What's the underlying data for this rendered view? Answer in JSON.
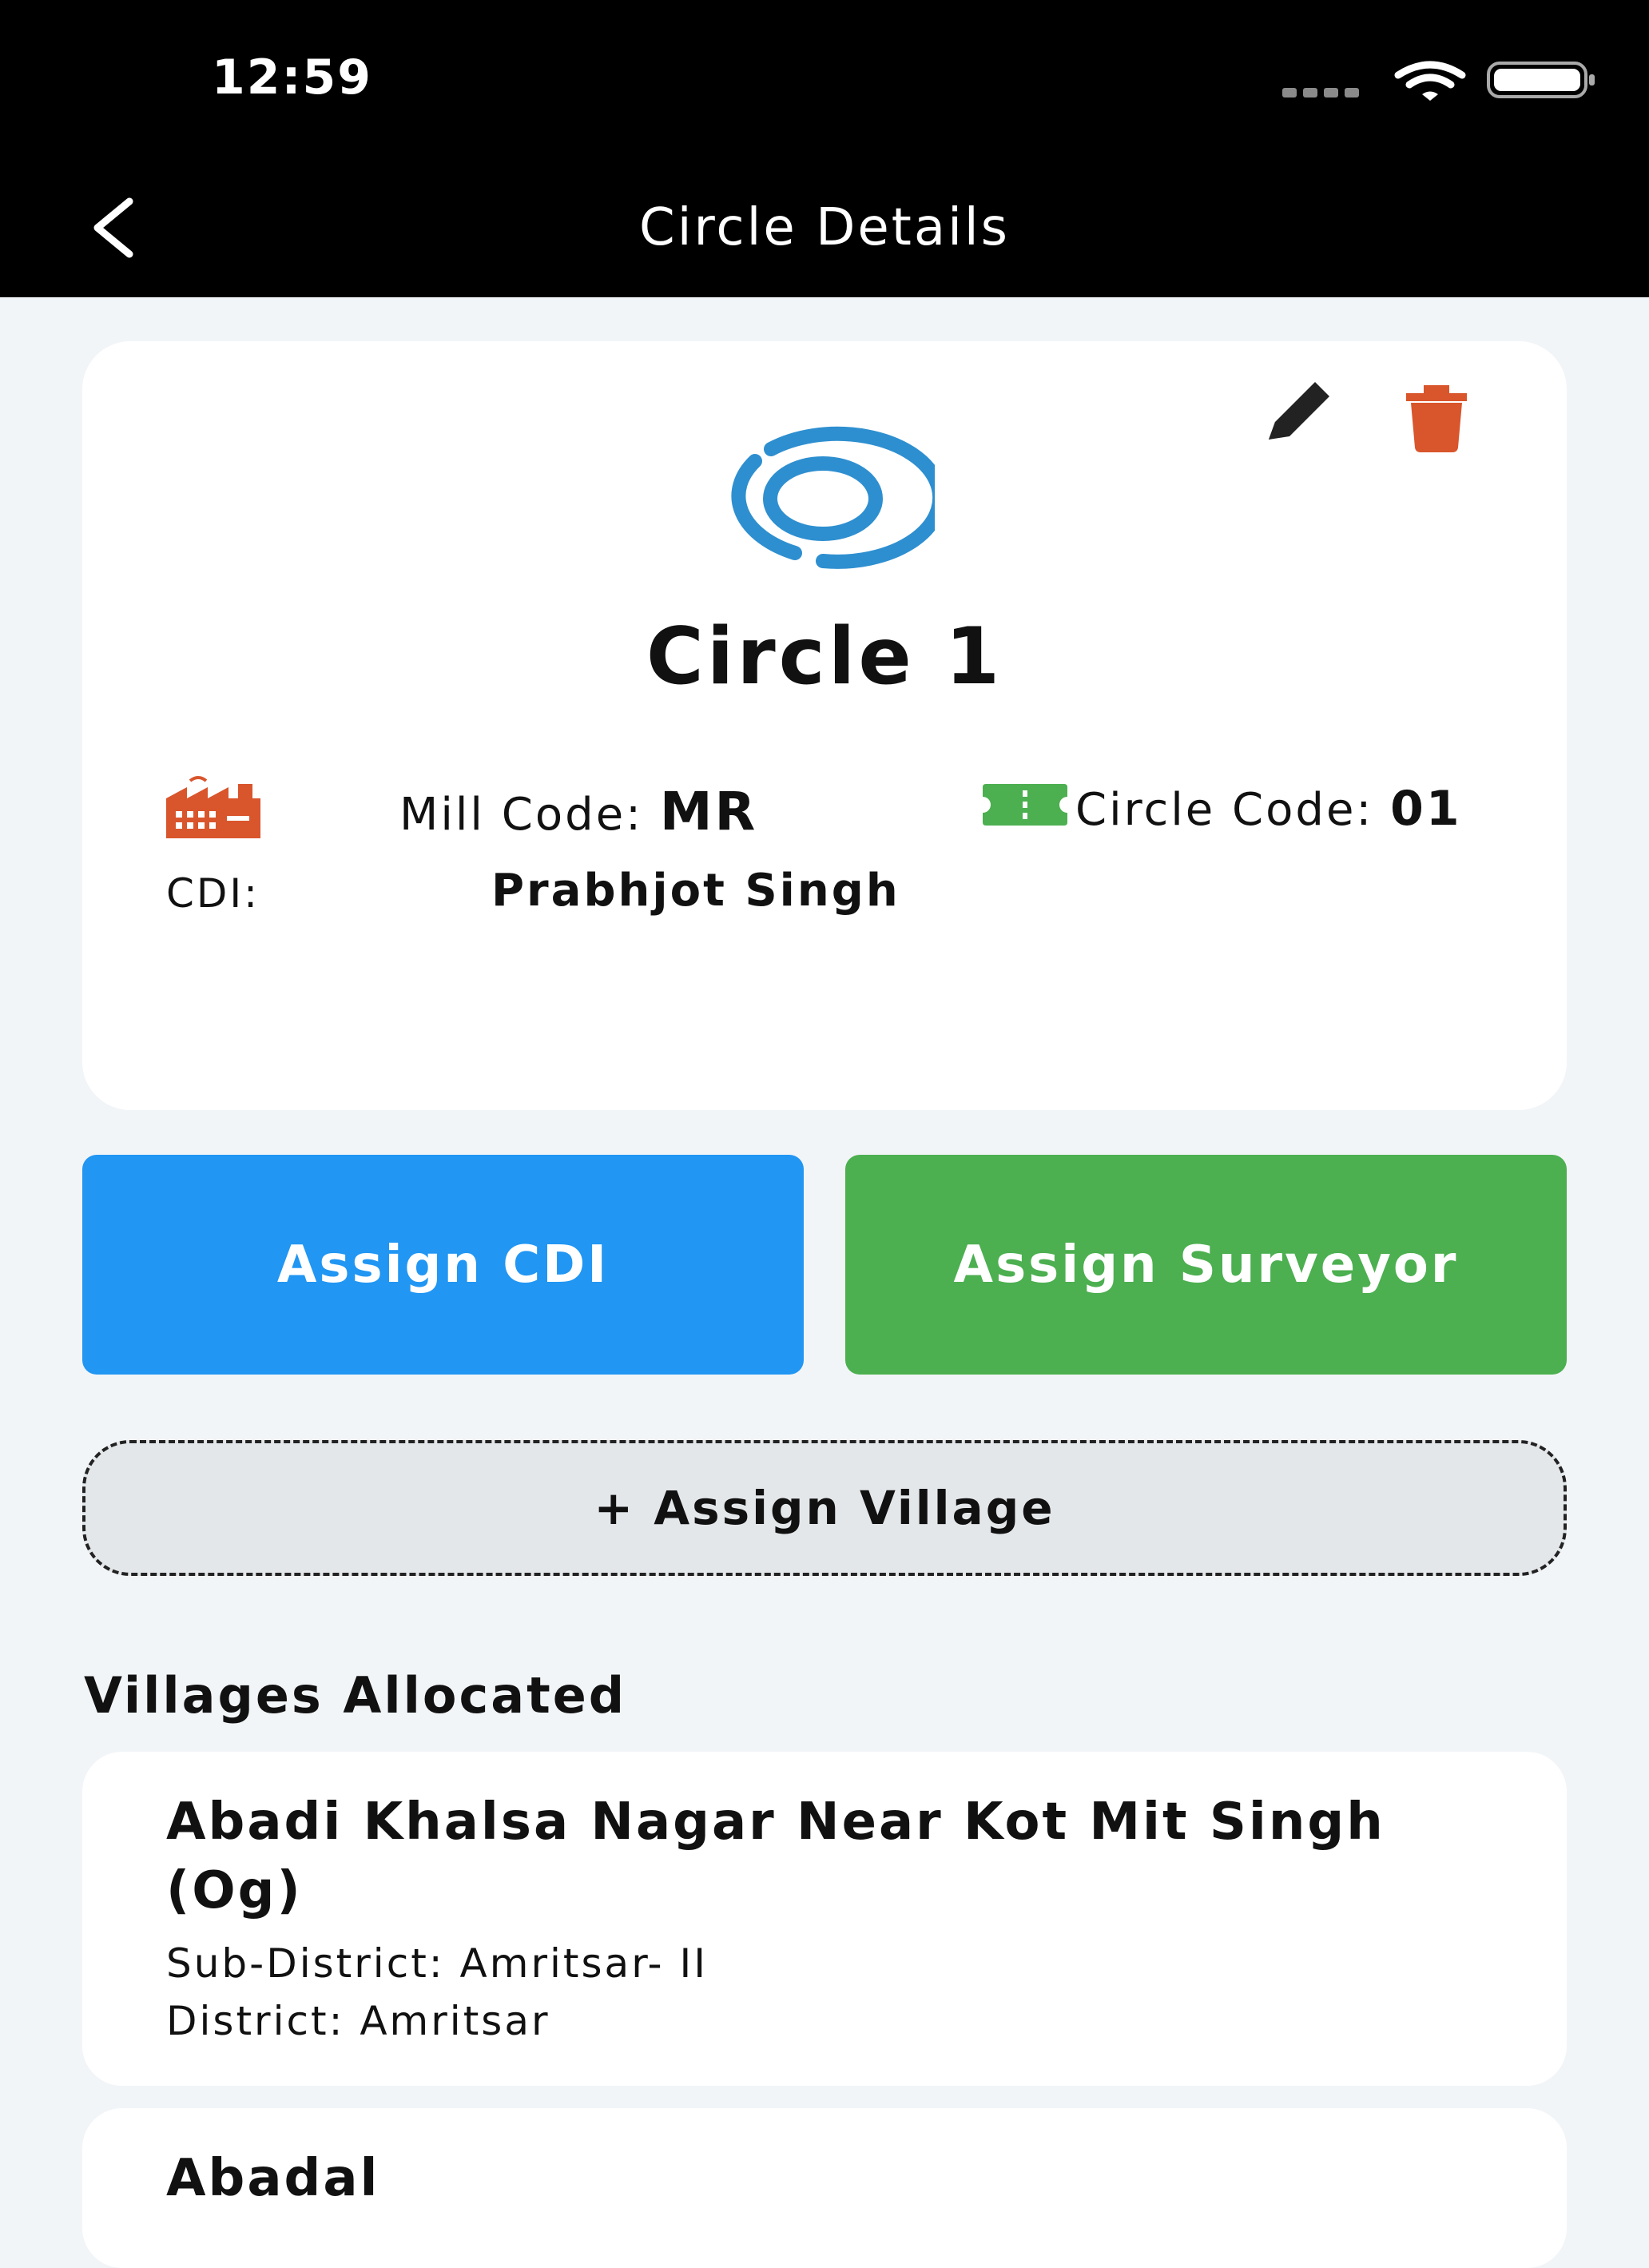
{
  "status_bar": {
    "time": "12:59"
  },
  "nav": {
    "title": "Circle Details"
  },
  "circle": {
    "name": "Circle 1",
    "mill_code_label": "Mill Code:",
    "mill_code_value": "MR",
    "circle_code_label": "Circle Code:",
    "circle_code_value": "01",
    "cdi_label": "CDI:",
    "cdi_value": "Prabhjot Singh"
  },
  "actions": {
    "assign_cdi": "Assign CDI",
    "assign_surveyor": "Assign Surveyor",
    "assign_village": "+ Assign Village"
  },
  "villages_section": {
    "title": "Villages Allocated",
    "items": [
      {
        "name": "Abadi Khalsa Nagar Near Kot Mit Singh (Og)",
        "sub_district": "Sub-District: Amritsar- II",
        "district": "District: Amritsar"
      },
      {
        "name": "Abadal"
      }
    ]
  },
  "colors": {
    "primary_blue": "#2196f3",
    "success_green": "#4caf50",
    "danger_orange": "#d9552c",
    "logo_blue": "#2e8fd0"
  },
  "icons": [
    "chevron-left-icon",
    "pencil-icon",
    "trash-icon",
    "circle-logo-icon",
    "factory-icon",
    "ticket-icon",
    "wifi-icon",
    "battery-icon"
  ]
}
